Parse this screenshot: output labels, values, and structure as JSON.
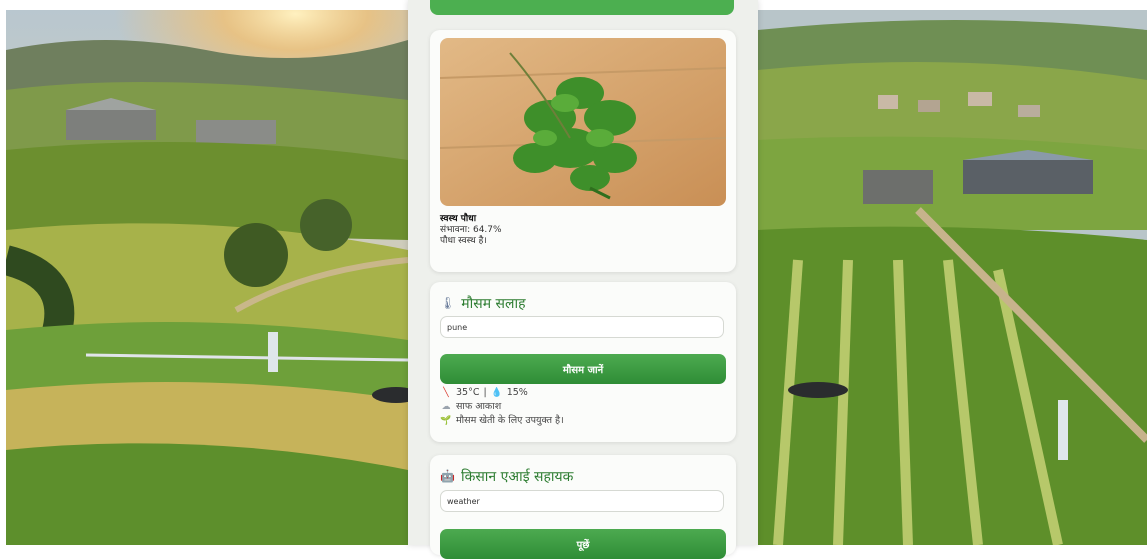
{
  "result": {
    "title": "स्वस्थ पौधा",
    "probability": "संभावना: 64.7%",
    "message": "पौधा स्वस्थ है।"
  },
  "weather": {
    "heading": "मौसम सलाह",
    "heading_icon": "thermometer-icon",
    "city_value": "pune",
    "button_label": "मौसम जानें",
    "temperature": "35°C",
    "separator": "|",
    "humidity": "15%",
    "sky": "साफ आकाश",
    "advice": "मौसम खेती के लिए उपयुक्त है।"
  },
  "assistant": {
    "heading": "किसान एआई सहायक",
    "heading_icon": "robot-icon",
    "query_value": "weather",
    "button_label": "पूछें"
  },
  "colors": {
    "accent": "#4caf50",
    "heading_text": "#2e7d32",
    "card_bg": "#fbfcfa",
    "column_bg": "#eef0ec"
  }
}
